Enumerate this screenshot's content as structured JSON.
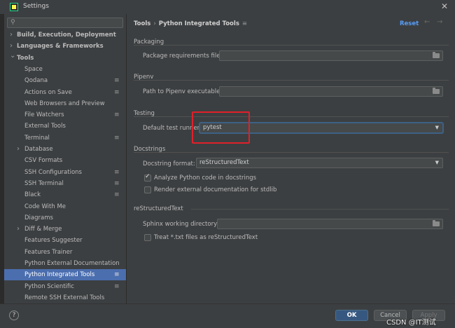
{
  "window": {
    "title": "Settings",
    "close_icon": "close-icon",
    "app_icon": "pycharm-icon"
  },
  "sidebar": {
    "search_placeholder": "",
    "items": [
      {
        "label": "Build, Execution, Deployment",
        "bold": true,
        "arrow": "›",
        "cfg": false
      },
      {
        "label": "Languages & Frameworks",
        "bold": true,
        "arrow": "›",
        "cfg": false
      },
      {
        "label": "Tools",
        "bold": true,
        "arrow": "⌄",
        "cfg": false
      },
      {
        "label": "Space",
        "cfg": false
      },
      {
        "label": "Qodana",
        "cfg": true
      },
      {
        "label": "Actions on Save",
        "cfg": true
      },
      {
        "label": "Web Browsers and Preview",
        "cfg": false
      },
      {
        "label": "File Watchers",
        "cfg": true
      },
      {
        "label": "External Tools",
        "cfg": false
      },
      {
        "label": "Terminal",
        "cfg": true
      },
      {
        "label": "Database",
        "arrow": "›",
        "cfg": false
      },
      {
        "label": "CSV Formats",
        "cfg": false
      },
      {
        "label": "SSH Configurations",
        "cfg": true
      },
      {
        "label": "SSH Terminal",
        "cfg": true
      },
      {
        "label": "Black",
        "cfg": true
      },
      {
        "label": "Code With Me",
        "cfg": false
      },
      {
        "label": "Diagrams",
        "cfg": false
      },
      {
        "label": "Diff & Merge",
        "arrow": "›",
        "cfg": false
      },
      {
        "label": "Features Suggester",
        "cfg": false
      },
      {
        "label": "Features Trainer",
        "cfg": false
      },
      {
        "label": "Python External Documentation",
        "cfg": false
      },
      {
        "label": "Python Integrated Tools",
        "cfg": true,
        "selected": true
      },
      {
        "label": "Python Scientific",
        "cfg": true
      },
      {
        "label": "Remote SSH External Tools",
        "cfg": false
      }
    ]
  },
  "header": {
    "crumb_parent": "Tools",
    "crumb_sep": "›",
    "crumb_current": "Python Integrated Tools",
    "menu_icon": "≡",
    "reset": "Reset",
    "back_icon": "←",
    "forward_icon": "→"
  },
  "packaging": {
    "title": "Packaging",
    "req_label": "Package requirements file:",
    "req_value": ""
  },
  "pipenv": {
    "title": "Pipenv",
    "path_label": "Path to Pipenv executable:",
    "path_value": ""
  },
  "testing": {
    "title": "Testing",
    "runner_label": "Default test runner:",
    "runner_value": "pytest"
  },
  "docstrings": {
    "title": "Docstrings",
    "format_label": "Docstring format:",
    "format_value": "reStructuredText",
    "analyze_label": "Analyze Python code in docstrings",
    "analyze_checked": true,
    "render_label": "Render external documentation for stdlib",
    "render_checked": false
  },
  "rest": {
    "title": "reStructuredText",
    "sphinx_label": "Sphinx working directory:",
    "sphinx_value": "",
    "treat_label": "Treat *.txt files as reStructuredText",
    "treat_checked": false
  },
  "footer": {
    "help": "?",
    "ok": "OK",
    "cancel": "Cancel",
    "apply": "Apply"
  },
  "watermark": "CSDN @IT测试",
  "colors": {
    "accent": "#4b6eaf",
    "link": "#589df6",
    "highlight": "#e0202a",
    "ok_button": "#365880"
  }
}
